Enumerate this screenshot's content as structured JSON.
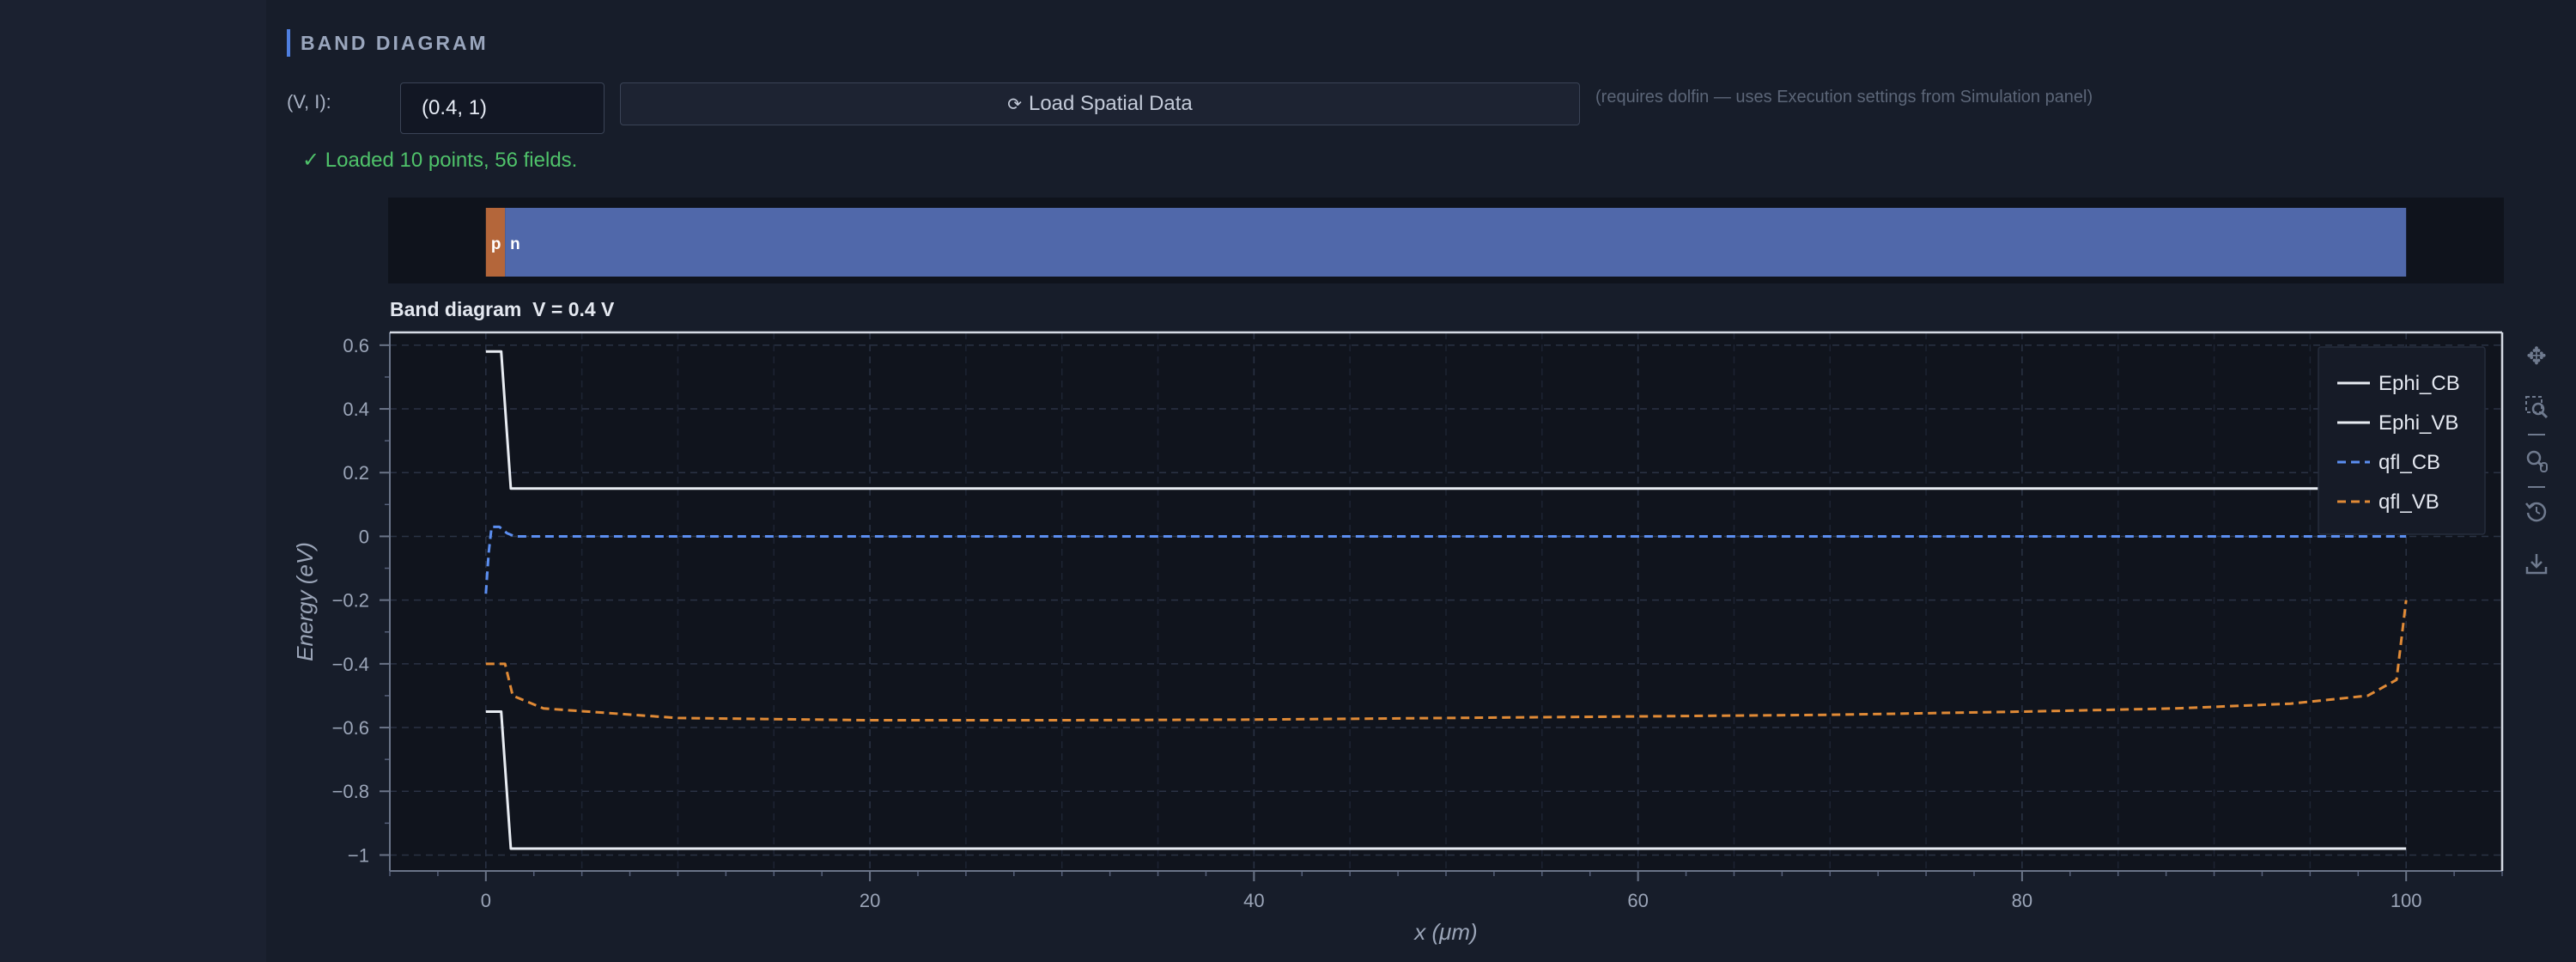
{
  "section": {
    "title": "BAND DIAGRAM"
  },
  "controls": {
    "vi_label": "(V, I):",
    "vi_value": "(0.4, 1)",
    "load_icon": "⟳",
    "load_label": "Load Spatial Data",
    "hint": "(requires dolfin — uses Execution settings from Simulation panel)"
  },
  "status": {
    "message": "✓ Loaded 10 points, 56 fields."
  },
  "layers": [
    {
      "label": "p",
      "x_start": 0,
      "x_end": 1,
      "color": "#b4663a"
    },
    {
      "label": "n",
      "x_start": 1,
      "x_end": 100,
      "color": "#5068aa"
    }
  ],
  "toolbar": {
    "pan": "pan-icon",
    "box_zoom": "box-zoom-icon",
    "wheel_zoom": "wheel-zoom-icon",
    "reset": "reset-icon",
    "save": "save-icon"
  },
  "chart_data": {
    "type": "line",
    "title": "Band diagram  V = 0.4 V",
    "xlabel": "x (μm)",
    "ylabel": "Energy (eV)",
    "xlim": [
      -5,
      105
    ],
    "ylim": [
      -1.05,
      0.64
    ],
    "xticks": [
      0,
      20,
      40,
      60,
      80,
      100
    ],
    "xtick_labels": [
      "0",
      "20",
      "40",
      "60",
      "80",
      "100"
    ],
    "yticks": [
      0.6,
      0.4,
      0.2,
      0,
      -0.2,
      -0.4,
      -0.6,
      -0.8,
      -1
    ],
    "ytick_labels": [
      "0.6",
      "0.4",
      "0.2",
      "0",
      "−0.2",
      "−0.4",
      "−0.6",
      "−0.8",
      "−1"
    ],
    "grid": true,
    "legend_position": "top-right",
    "series": [
      {
        "name": "Ephi_CB",
        "color": "#e8ecf2",
        "dash": "solid",
        "x": [
          0,
          0.8,
          1.3,
          100
        ],
        "y": [
          0.58,
          0.58,
          0.15,
          0.15
        ]
      },
      {
        "name": "Ephi_VB",
        "color": "#e8ecf2",
        "dash": "solid",
        "x": [
          0,
          0.8,
          1.3,
          100
        ],
        "y": [
          -0.55,
          -0.55,
          -0.98,
          -0.98
        ]
      },
      {
        "name": "qfl_CB",
        "color": "#5b8ef0",
        "dash": "dashed",
        "x": [
          0,
          0.15,
          0.3,
          0.7,
          1.1,
          1.5,
          3,
          100
        ],
        "y": [
          -0.18,
          -0.05,
          0.03,
          0.03,
          0.01,
          0.0,
          0.0,
          0.0
        ]
      },
      {
        "name": "qfl_VB",
        "color": "#e08a36",
        "dash": "dashed",
        "x": [
          0,
          1,
          1.4,
          3,
          10,
          20,
          30,
          40,
          50,
          60,
          70,
          80,
          88,
          94,
          98,
          99.5,
          100
        ],
        "y": [
          -0.4,
          -0.4,
          -0.5,
          -0.54,
          -0.57,
          -0.577,
          -0.577,
          -0.575,
          -0.57,
          -0.565,
          -0.56,
          -0.55,
          -0.54,
          -0.525,
          -0.5,
          -0.45,
          -0.2
        ]
      }
    ]
  }
}
